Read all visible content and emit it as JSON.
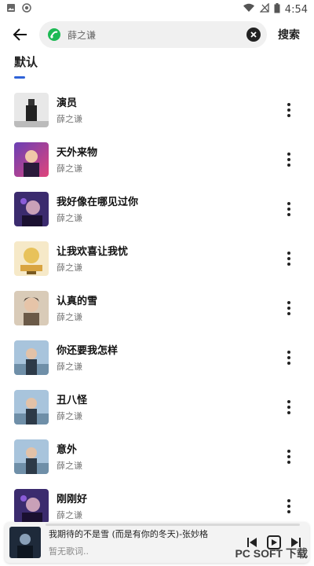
{
  "status_bar": {
    "time": "4:54",
    "left_icons": [
      "gallery-icon",
      "record-icon"
    ],
    "right_icons": [
      "wifi-icon",
      "signal-icon",
      "battery-icon"
    ]
  },
  "search": {
    "back_icon": "arrow-left-icon",
    "logo_icon": "music-note-logo-icon",
    "query": "薛之谦",
    "clear_icon": "close-circle-icon",
    "action_label": "搜索"
  },
  "tabs": [
    {
      "label": "默认",
      "active": true
    }
  ],
  "songs": [
    {
      "title": "演员",
      "artist": "薛之谦"
    },
    {
      "title": "天外来物",
      "artist": "薛之谦"
    },
    {
      "title": "我好像在哪见过你",
      "artist": "薛之谦"
    },
    {
      "title": "让我欢喜让我忧",
      "artist": "薛之谦"
    },
    {
      "title": "认真的雪",
      "artist": "薛之谦"
    },
    {
      "title": "你还要我怎样",
      "artist": "薛之谦"
    },
    {
      "title": "丑八怪",
      "artist": "薛之谦"
    },
    {
      "title": "意外",
      "artist": "薛之谦"
    },
    {
      "title": "刚刚好",
      "artist": "薛之谦"
    }
  ],
  "player": {
    "title": "我期待的不是雪 (而是有你的冬天)-张妙格",
    "lyric": "暂无歌词..",
    "controls": [
      "previous-icon",
      "play-icon",
      "next-icon"
    ]
  },
  "watermark": {
    "text": "PC SOFT 下载"
  },
  "colors": {
    "accent": "#2f63d8",
    "background": "#ffffff"
  }
}
